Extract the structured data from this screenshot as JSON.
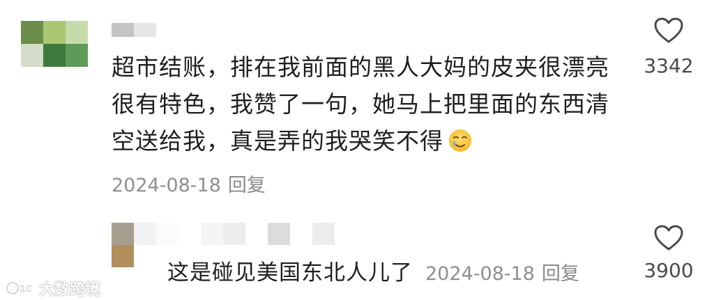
{
  "comments": [
    {
      "avatar_colors": [
        "#6c8c49",
        "#a8c873",
        "#c5dcaa",
        "#d2dcc6",
        "#3f7a3d",
        "#5e9a5a"
      ],
      "username_colors": [
        "#c4c4c4",
        "#e6e6e6"
      ],
      "text_lines": [
        "超市结账，排在我前面的黑人大妈的皮夹很漂亮",
        "很有特色，我赞了一句，她马上把里面的东西清",
        "空送给我，真是弄的我哭笑不得"
      ],
      "emoji": "tearful-smile-emoji",
      "date": "2024-08-18",
      "reply_label": "回复",
      "like_icon": "heart-outline-icon",
      "likes": "3342"
    },
    {
      "avatar_colors": [
        "#a89e90",
        "#b08f5c"
      ],
      "username_colors": [
        "#f2f2f2",
        "#fbfbfb",
        "#ffffff",
        "#f4f4f4",
        "#ededed",
        "#ffffff",
        "#dcdcdc",
        "#ffffff",
        "#ececec"
      ],
      "text": "这是碰见美国东北人儿了",
      "date": "2024-08-18",
      "reply_label": "回复",
      "like_icon": "heart-outline-icon",
      "likes": "3900"
    }
  ],
  "watermark": {
    "text": "大数跨境"
  },
  "colors": {
    "text": "#1f1f1f",
    "meta": "#8f8f8f",
    "icon": "#4a4a4a"
  }
}
